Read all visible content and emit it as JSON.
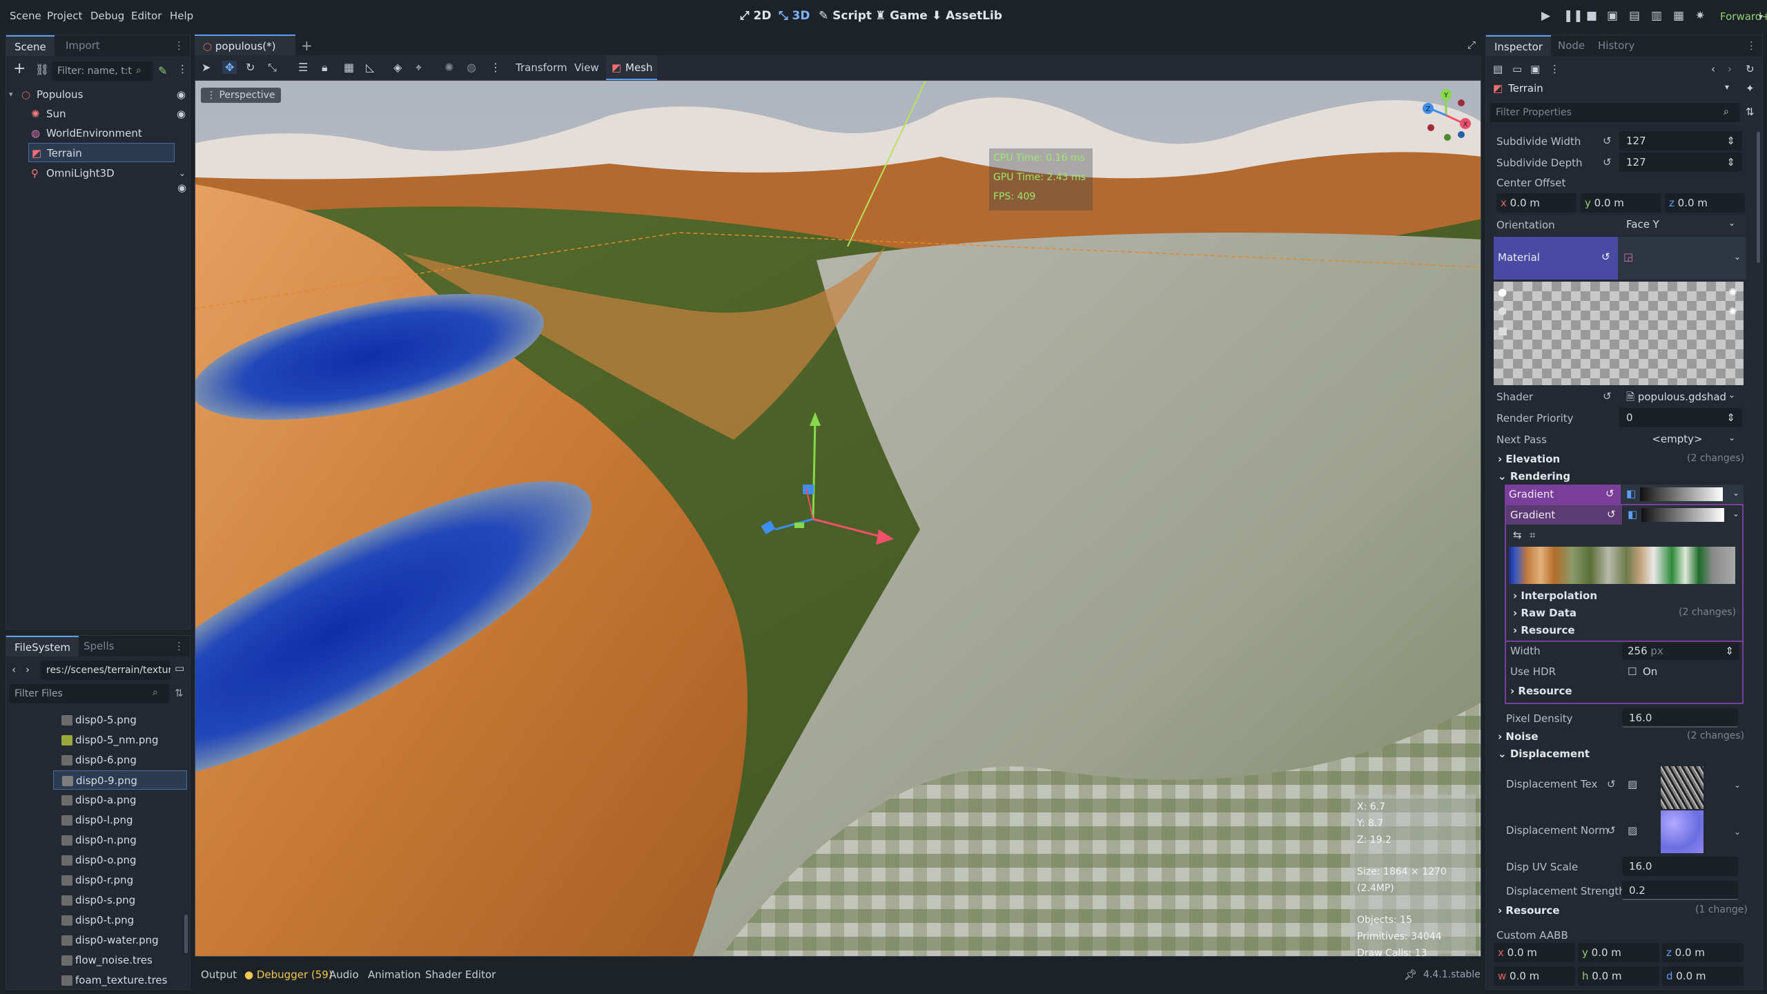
{
  "menu": [
    "Scene",
    "Project",
    "Debug",
    "Editor",
    "Help"
  ],
  "modes": {
    "m2d": "2D",
    "m3d": "3D",
    "script": "Script",
    "game": "Game",
    "asset": "AssetLib"
  },
  "renderer": "Forward+",
  "scene_dock": {
    "tabs": [
      "Scene",
      "Import"
    ],
    "filter_placeholder": "Filter: name, t:t",
    "nodes": [
      {
        "label": "Populous",
        "color": "#e06666"
      },
      {
        "label": "Sun",
        "color": "#f07a7a"
      },
      {
        "label": "WorldEnvironment",
        "color": "#d97ab3"
      },
      {
        "label": "Terrain",
        "color": "#f07070"
      },
      {
        "label": "OmniLight3D",
        "color": "#f07a7a"
      }
    ]
  },
  "filesystem": {
    "tabs": [
      "FileSystem",
      "Spells"
    ],
    "path": "res://scenes/terrain/textur",
    "filter_placeholder": "Filter Files",
    "files": [
      "disp0-5.png",
      "disp0-5_nm.png",
      "disp0-6.png",
      "disp0-9.png",
      "disp0-a.png",
      "disp0-l.png",
      "disp0-n.png",
      "disp0-o.png",
      "disp0-r.png",
      "disp0-s.png",
      "disp0-t.png",
      "disp0-water.png",
      "flow_noise.tres",
      "foam_texture.tres"
    ],
    "thumb_colors": [
      "#6b6b6b",
      "#9aa83a",
      "#6b6b6b",
      "#7d7d7d",
      "#6b6b6b",
      "#6b6b6b",
      "#6b6b6b",
      "#6b6b6b",
      "#6b6b6b",
      "#6b6b6b",
      "#6b6b6b",
      "#6b6b6b",
      "#6b6b6b",
      "#6b6b6b"
    ]
  },
  "editor_tab": "populous(*)",
  "viewport_menus": {
    "transform": "Transform",
    "view": "View",
    "mesh": "Mesh",
    "perspective": "Perspective"
  },
  "stats": {
    "cpu": "CPU Time: 0.16 ms",
    "gpu": "GPU Time: 2.43 ms",
    "fps": "FPS: 409"
  },
  "info": {
    "x": "X: 6.7",
    "y": "Y: 8.7",
    "z": "Z: 19.2",
    "size": "Size: 1864 × 1270 (2.4MP)",
    "objects": "Objects: 15",
    "primitives": "Primitives: 34044",
    "draws": "Draw Calls: 13"
  },
  "bottom_tabs": {
    "output": "Output",
    "debugger": "Debugger (59)",
    "audio": "Audio",
    "animation": "Animation",
    "shader": "Shader Editor"
  },
  "version": "4.4.1.stable",
  "inspector": {
    "tabs": [
      "Inspector",
      "Node",
      "History"
    ],
    "object": "Terrain",
    "filter_placeholder": "Filter Properties",
    "subdivide_width_label": "Subdivide Width",
    "subdivide_width": "127",
    "subdivide_depth_label": "Subdivide Depth",
    "subdivide_depth": "127",
    "center_offset": "Center Offset",
    "co_x": "0.0 m",
    "co_y": "0.0 m",
    "co_z": "0.0 m",
    "orientation_label": "Orientation",
    "orientation": "Face Y",
    "material": "Material",
    "shader_label": "Shader",
    "shader": "populous.gdshad",
    "render_priority_label": "Render Priority",
    "render_priority": "0",
    "next_pass_label": "Next Pass",
    "next_pass": "<empty>",
    "elevation": "Elevation",
    "elevation_changes": "(2 changes)",
    "rendering": "Rendering",
    "gradient1": "Gradient",
    "gradient2": "Gradient",
    "interpolation": "Interpolation",
    "raw_data": "Raw Data",
    "raw_data_changes": "(2 changes)",
    "resource1": "Resource",
    "width_label": "Width",
    "width": "256",
    "width_unit": "px",
    "use_hdr_label": "Use HDR",
    "use_hdr": "On",
    "resource2": "Resource",
    "pixel_density_label": "Pixel Density",
    "pixel_density": "16.0",
    "noise": "Noise",
    "noise_changes": "(2 changes)",
    "displacement": "Displacement",
    "disp_tex_label": "Displacement Tex",
    "disp_norm_label": "Displacement Norm",
    "disp_uv_label": "Disp UV Scale",
    "disp_uv": "16.0",
    "disp_strength_label": "Displacement Strength",
    "disp_strength": "0.2",
    "resource3": "Resource",
    "resource3_changes": "(1 change)",
    "custom_aabb": "Custom AABB",
    "aabb_x": "0.0 m",
    "aabb_y": "0.0 m",
    "aabb_z": "0.0 m",
    "aabb_w": "0.0 m",
    "aabb_h": "0.0 m",
    "aabb_d": "0.0 m"
  }
}
